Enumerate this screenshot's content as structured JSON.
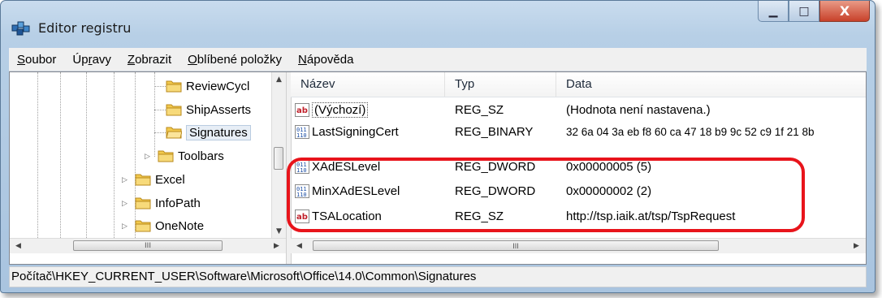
{
  "window": {
    "title": "Editor registru",
    "buttons": {
      "minimize": "▁",
      "maximize": "□",
      "close": "X"
    }
  },
  "menu": [
    {
      "label": "Soubor"
    },
    {
      "label": "Úpravy"
    },
    {
      "label": "Zobrazit"
    },
    {
      "label": "Oblíbené položky"
    },
    {
      "label": "Nápověda"
    }
  ],
  "tree": {
    "nodes": [
      {
        "label": "ReviewCycl",
        "expander": "",
        "selected": false
      },
      {
        "label": "ShipAsserts",
        "expander": "",
        "selected": false
      },
      {
        "label": "Signatures",
        "expander": "",
        "selected": true
      },
      {
        "label": "Toolbars",
        "expander": "▷",
        "selected": false
      },
      {
        "label": "Excel",
        "expander": "▷",
        "selected": false
      },
      {
        "label": "InfoPath",
        "expander": "▷",
        "selected": false
      },
      {
        "label": "OneNote",
        "expander": "▷",
        "selected": false
      }
    ],
    "scroll": {
      "up": "▲",
      "down": "▼",
      "left": "◀",
      "right": "▶",
      "grip": "III"
    }
  },
  "list": {
    "columns": {
      "name": "Název",
      "type": "Typ",
      "data": "Data"
    },
    "rows": [
      {
        "icon": "string-value-icon",
        "name": "(Výchozí)",
        "type": "REG_SZ",
        "data": "(Hodnota není nastavena.)"
      },
      {
        "icon": "binary-value-icon",
        "name": "LastSigningCert",
        "type": "REG_BINARY",
        "data": "32 6a 04 3a eb f8 60 ca 47 18 b9 9c 52 c9 1f 21 8b"
      },
      {
        "icon": "binary-value-icon",
        "name": "XAdESLevel",
        "type": "REG_DWORD",
        "data": "0x00000005 (5)"
      },
      {
        "icon": "binary-value-icon",
        "name": "MinXAdESLevel",
        "type": "REG_DWORD",
        "data": "0x00000002 (2)"
      },
      {
        "icon": "string-value-icon",
        "name": "TSALocation",
        "type": "REG_SZ",
        "data": "http://tsp.iaik.at/tsp/TspRequest"
      }
    ],
    "scroll": {
      "left": "◀",
      "right": "▶",
      "grip": "III"
    }
  },
  "status": {
    "path": "Počítač\\HKEY_CURRENT_USER\\Software\\Microsoft\\Office\\14.0\\Common\\Signatures"
  },
  "colors": {
    "highlight": "#e8141b",
    "folder": "#f2c94c"
  }
}
